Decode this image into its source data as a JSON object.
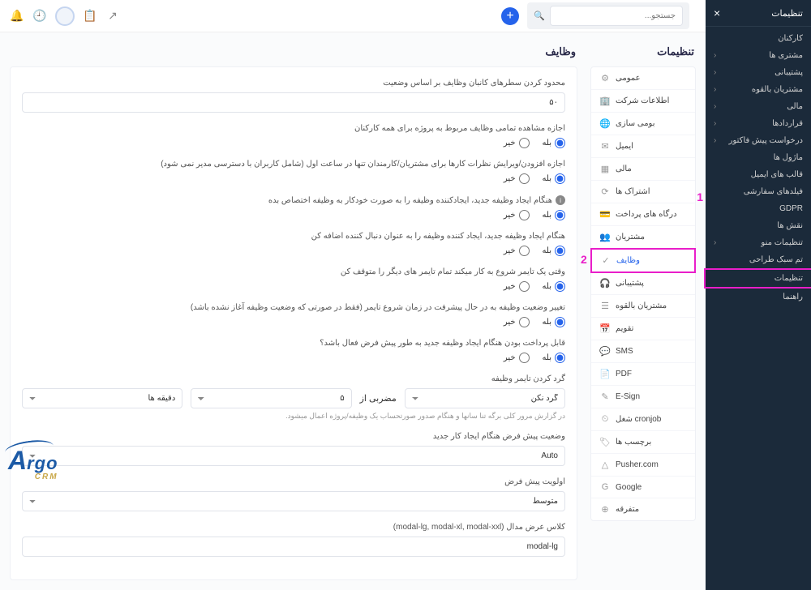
{
  "darkSidebar": {
    "title": "تنظیمات",
    "close": "×",
    "items": [
      {
        "label": "کارکنان",
        "chev": false
      },
      {
        "label": "مشتری ها",
        "chev": true
      },
      {
        "label": "پشتیبانی",
        "chev": true
      },
      {
        "label": "مشتریان بالقوه",
        "chev": true
      },
      {
        "label": "مالی",
        "chev": true
      },
      {
        "label": "قراردادها",
        "chev": true
      },
      {
        "label": "درخواست پیش فاکتور",
        "chev": true
      },
      {
        "label": "ماژول ها",
        "chev": false
      },
      {
        "label": "قالب های ایمیل",
        "chev": false
      },
      {
        "label": "فیلدهای سفارشی",
        "chev": false
      },
      {
        "label": "GDPR",
        "chev": false
      },
      {
        "label": "نقش ها",
        "chev": false
      },
      {
        "label": "تنظیمات منو",
        "chev": true
      },
      {
        "label": "تم سبک طراحی",
        "chev": false
      },
      {
        "label": "تنظیمات",
        "chev": false,
        "hl": 1
      },
      {
        "label": "راهنما",
        "chev": false
      }
    ]
  },
  "topbar": {
    "searchPlaceholder": "جستجو..."
  },
  "settingsCol": {
    "title": "تنظیمات",
    "items": [
      {
        "label": "عمومی",
        "icon": "⚙"
      },
      {
        "label": "اطلاعات شرکت",
        "icon": "🏢"
      },
      {
        "label": "بومی سازی",
        "icon": "🌐"
      },
      {
        "label": "ایمیل",
        "icon": "✉"
      },
      {
        "label": "مالی",
        "icon": "▦"
      },
      {
        "label": "اشتراک ها",
        "icon": "⟳"
      },
      {
        "label": "درگاه های پرداخت",
        "icon": "💳"
      },
      {
        "label": "مشتریان",
        "icon": "👥"
      },
      {
        "label": "وظایف",
        "icon": "✓",
        "active": true,
        "hl": 2
      },
      {
        "label": "پشتیبانی",
        "icon": "🎧"
      },
      {
        "label": "مشتریان بالقوه",
        "icon": "☰"
      },
      {
        "label": "تقویم",
        "icon": "📅"
      },
      {
        "label": "SMS",
        "icon": "💬"
      },
      {
        "label": "PDF",
        "icon": "📄"
      },
      {
        "label": "E-Sign",
        "icon": "✎"
      },
      {
        "label": "cronjob شغل",
        "icon": "⏲"
      },
      {
        "label": "برچسب ها",
        "icon": "🏷"
      },
      {
        "label": "Pusher.com",
        "icon": "△"
      },
      {
        "label": "Google",
        "icon": "G"
      },
      {
        "label": "متفرقه",
        "icon": "⊕"
      }
    ]
  },
  "form": {
    "title": "وظایف",
    "limitLabel": "محدود کردن سطرهای کانبان وظایف بر اساس وضعیت",
    "limitValue": "۵۰",
    "q1": "اجازه مشاهده تمامی وظایف مربوط به پروژه برای همه کارکنان",
    "q2": "اجازه افزودن/ویرایش نظرات کارها برای مشتریان/کارمندان تنها در ساعت اول (شامل کاربران با دسترسی مدیر نمی شود)",
    "q3": "هنگام ایجاد وظیفه جدید، ایجادکننده وظیفه را به صورت خودکار به وظیفه اختصاص بده",
    "q4": "هنگام ایجاد وظیفه جدید، ایجاد کننده وظیفه را به عنوان دنبال کننده اضافه کن",
    "q5": "وقتی یک تایمر شروع به کار میکند تمام تایمر های دیگر را متوقف کن",
    "q6": "تغییر وضعیت وظیفه به در حال پیشرفت در زمان شروع تایمر (فقط در صورتی که وضعیت وظیفه آغاز نشده باشد)",
    "q7": "قابل پرداخت بودن هنگام ایجاد وظیفه جدید به طور پیش فرض فعال باشد؟",
    "yes": "بله",
    "no": "خیر",
    "roundLabel": "گرد کردن تایمر وظیفه",
    "roundNone": "گرد نکن",
    "roundMultLabel": "مضربی از",
    "roundVal": "۵",
    "roundUnit": "دقیقه ها",
    "roundHint": "در گزارش مرور کلی برگه تنا سانها و هنگام صدور صورتحساب یک وظیفه/پروژه اعمال میشود.",
    "statusLabel": "وضعیت پیش فرض هنگام ایجاد کار جدید",
    "statusVal": "Auto",
    "priorityLabel": "اولویت پیش فرض",
    "priorityVal": "متوسط",
    "modalLabel": "کلاس عرض مدال (modal-lg, modal-xl, modal-xxl)",
    "modalVal": "modal-lg"
  },
  "logo": {
    "brand": "rgo",
    "sub": "CRM"
  }
}
